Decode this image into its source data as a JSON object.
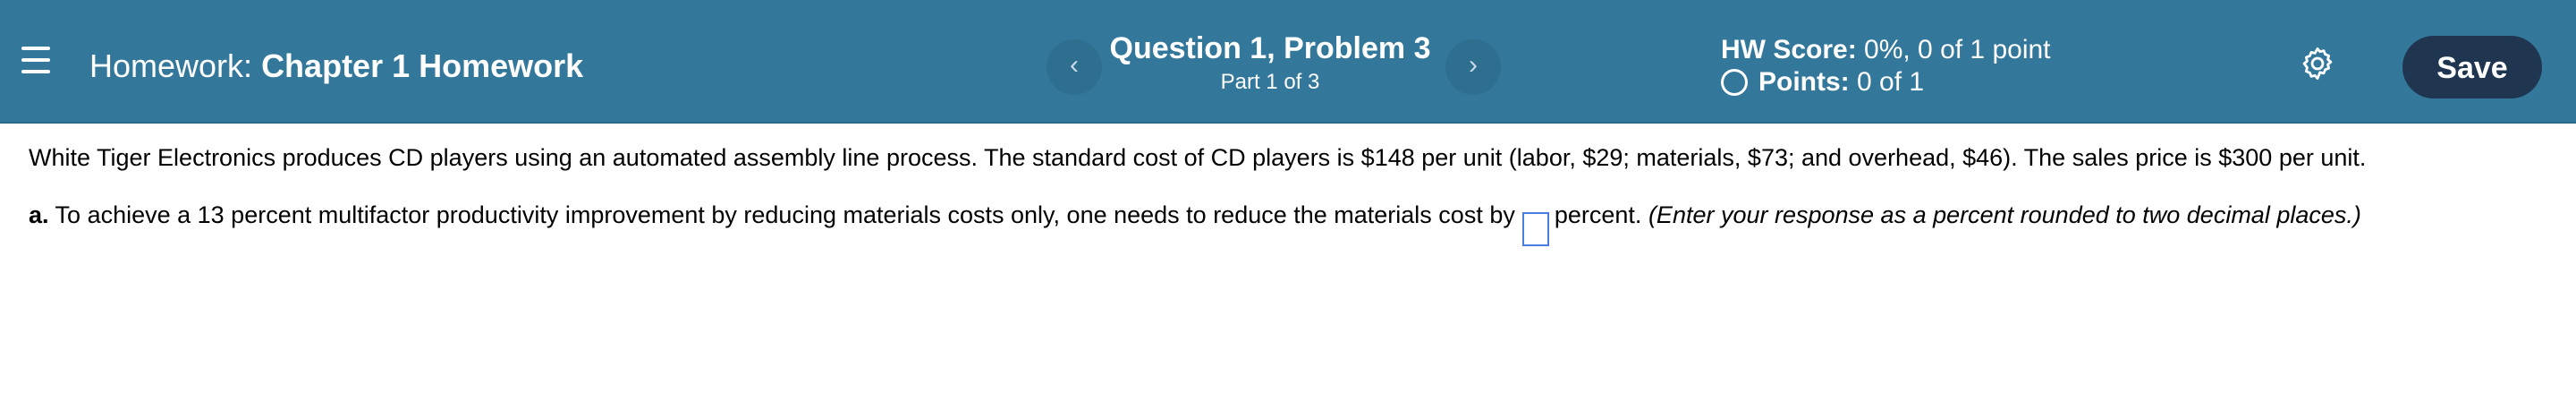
{
  "header": {
    "menu_icon": "hamburger-menu-icon",
    "homework_prefix": "Homework:",
    "homework_name": "Chapter 1 Homework",
    "question_title": "Question 1, Problem 3",
    "question_part": "Part 1 of 3",
    "prev_glyph": "‹",
    "next_glyph": "›",
    "score_label": "HW Score:",
    "score_value": "0%, 0 of 1 point",
    "points_label": "Points:",
    "points_value": "0 of 1",
    "settings_icon": "gear-icon",
    "save_label": "Save"
  },
  "question": {
    "intro": "White Tiger Electronics produces CD players using an automated assembly line process. The standard cost of CD players is $148 per unit (labor, $29; materials, $73; and overhead, $46). The sales price is $300 per unit.",
    "part_a_letter": "a.",
    "part_a_text": "To achieve a 13 percent multifactor productivity improvement by reducing materials costs only, one needs to reduce the materials cost by",
    "answer_value": "",
    "after_box": "percent.",
    "hint": "(Enter your response as a percent rounded to two decimal places.)"
  },
  "colors": {
    "header_bg": "#33789a",
    "save_bg": "#1f3550",
    "answer_border": "#4a7de0"
  }
}
